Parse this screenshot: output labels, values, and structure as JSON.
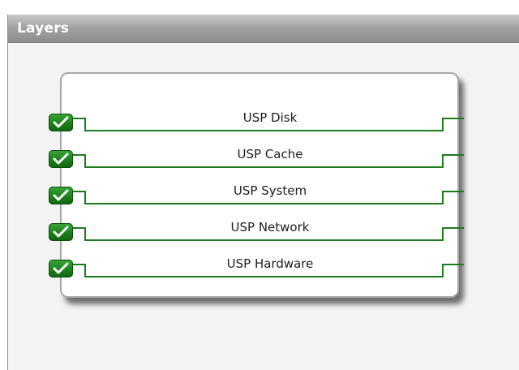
{
  "panel": {
    "title": "Layers"
  },
  "layers": [
    {
      "label": "USP Disk",
      "checked": true
    },
    {
      "label": "USP Cache",
      "checked": true
    },
    {
      "label": "USP System",
      "checked": true
    },
    {
      "label": "USP Network",
      "checked": true
    },
    {
      "label": "USP Hardware",
      "checked": true
    }
  ],
  "icons": {
    "check": "checkmark-icon"
  },
  "colors": {
    "check_green": "#1a7d1a",
    "line_green": "#1f7a1f",
    "titlebar": "#a3a3a3"
  }
}
